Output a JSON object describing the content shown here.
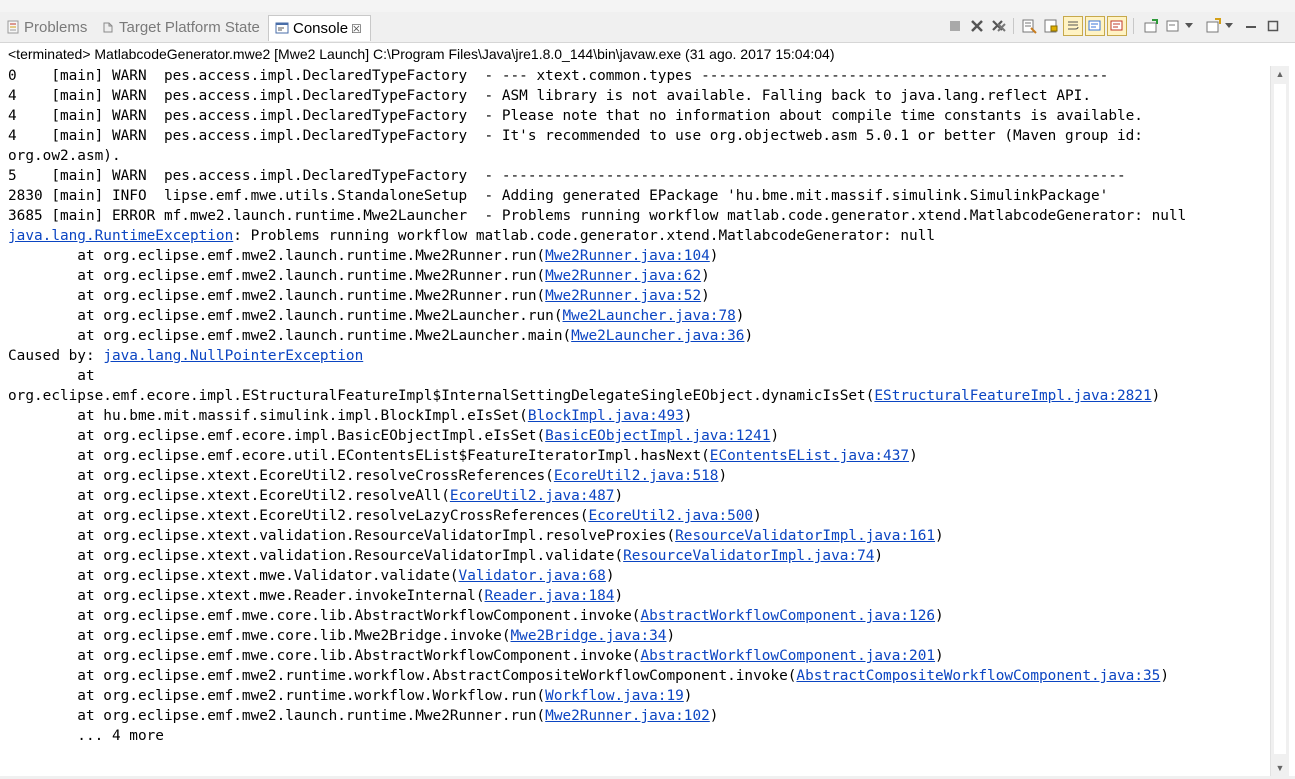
{
  "tabs": [
    {
      "label": "Problems",
      "icon": "problems-icon"
    },
    {
      "label": "Target Platform State",
      "icon": "target-platform-icon"
    },
    {
      "label": "Console",
      "icon": "console-icon",
      "close": "☒"
    }
  ],
  "status": "<terminated> MatlabcodeGenerator.mwe2 [Mwe2 Launch] C:\\Program Files\\Java\\jre1.8.0_144\\bin\\javaw.exe (31 ago. 2017 15:04:04)",
  "colors": {
    "link": "#0b45c2",
    "accent": "#3874d8"
  },
  "console": [
    [
      {
        "t": "0    [main] WARN  pes.access.impl.DeclaredTypeFactory  - --- xtext.common.types -----------------------------------------------"
      }
    ],
    [
      {
        "t": "4    [main] WARN  pes.access.impl.DeclaredTypeFactory  - ASM library is not available. Falling back to java.lang.reflect API."
      }
    ],
    [
      {
        "t": "4    [main] WARN  pes.access.impl.DeclaredTypeFactory  - Please note that no information about compile time constants is available."
      }
    ],
    [
      {
        "t": "4    [main] WARN  pes.access.impl.DeclaredTypeFactory  - It's recommended to use org.objectweb.asm 5.0.1 or better (Maven group id:"
      }
    ],
    [
      {
        "t": "org.ow2.asm)."
      }
    ],
    [
      {
        "t": "5    [main] WARN  pes.access.impl.DeclaredTypeFactory  - ------------------------------------------------------------------------"
      }
    ],
    [
      {
        "t": "2830 [main] INFO  lipse.emf.mwe.utils.StandaloneSetup  - Adding generated EPackage 'hu.bme.mit.massif.simulink.SimulinkPackage'"
      }
    ],
    [
      {
        "t": "3685 [main] ERROR mf.mwe2.launch.runtime.Mwe2Launcher  - Problems running workflow matlab.code.generator.xtend.MatlabcodeGenerator: null"
      }
    ],
    [
      {
        "t": "java.lang.RuntimeException",
        "link": true
      },
      {
        "t": ": Problems running workflow matlab.code.generator.xtend.MatlabcodeGenerator: null"
      }
    ],
    [
      {
        "t": "        at org.eclipse.emf.mwe2.launch.runtime.Mwe2Runner.run("
      },
      {
        "t": "Mwe2Runner.java:104",
        "link": true
      },
      {
        "t": ")"
      }
    ],
    [
      {
        "t": "        at org.eclipse.emf.mwe2.launch.runtime.Mwe2Runner.run("
      },
      {
        "t": "Mwe2Runner.java:62",
        "link": true
      },
      {
        "t": ")"
      }
    ],
    [
      {
        "t": "        at org.eclipse.emf.mwe2.launch.runtime.Mwe2Runner.run("
      },
      {
        "t": "Mwe2Runner.java:52",
        "link": true
      },
      {
        "t": ")"
      }
    ],
    [
      {
        "t": "        at org.eclipse.emf.mwe2.launch.runtime.Mwe2Launcher.run("
      },
      {
        "t": "Mwe2Launcher.java:78",
        "link": true
      },
      {
        "t": ")"
      }
    ],
    [
      {
        "t": "        at org.eclipse.emf.mwe2.launch.runtime.Mwe2Launcher.main("
      },
      {
        "t": "Mwe2Launcher.java:36",
        "link": true
      },
      {
        "t": ")"
      }
    ],
    [
      {
        "t": "Caused by: "
      },
      {
        "t": "java.lang.NullPointerException",
        "link": true
      }
    ],
    [
      {
        "t": "        at"
      }
    ],
    [
      {
        "t": "org.eclipse.emf.ecore.impl.EStructuralFeatureImpl$InternalSettingDelegateSingleEObject.dynamicIsSet("
      },
      {
        "t": "EStructuralFeatureImpl.java:2821",
        "link": true
      },
      {
        "t": ")"
      }
    ],
    [
      {
        "t": "        at hu.bme.mit.massif.simulink.impl.BlockImpl.eIsSet("
      },
      {
        "t": "BlockImpl.java:493",
        "link": true
      },
      {
        "t": ")"
      }
    ],
    [
      {
        "t": "        at org.eclipse.emf.ecore.impl.BasicEObjectImpl.eIsSet("
      },
      {
        "t": "BasicEObjectImpl.java:1241",
        "link": true
      },
      {
        "t": ")"
      }
    ],
    [
      {
        "t": "        at org.eclipse.emf.ecore.util.EContentsEList$FeatureIteratorImpl.hasNext("
      },
      {
        "t": "EContentsEList.java:437",
        "link": true
      },
      {
        "t": ")"
      }
    ],
    [
      {
        "t": "        at org.eclipse.xtext.EcoreUtil2.resolveCrossReferences("
      },
      {
        "t": "EcoreUtil2.java:518",
        "link": true
      },
      {
        "t": ")"
      }
    ],
    [
      {
        "t": "        at org.eclipse.xtext.EcoreUtil2.resolveAll("
      },
      {
        "t": "EcoreUtil2.java:487",
        "link": true
      },
      {
        "t": ")"
      }
    ],
    [
      {
        "t": "        at org.eclipse.xtext.EcoreUtil2.resolveLazyCrossReferences("
      },
      {
        "t": "EcoreUtil2.java:500",
        "link": true
      },
      {
        "t": ")"
      }
    ],
    [
      {
        "t": "        at org.eclipse.xtext.validation.ResourceValidatorImpl.resolveProxies("
      },
      {
        "t": "ResourceValidatorImpl.java:161",
        "link": true
      },
      {
        "t": ")"
      }
    ],
    [
      {
        "t": "        at org.eclipse.xtext.validation.ResourceValidatorImpl.validate("
      },
      {
        "t": "ResourceValidatorImpl.java:74",
        "link": true
      },
      {
        "t": ")"
      }
    ],
    [
      {
        "t": "        at org.eclipse.xtext.mwe.Validator.validate("
      },
      {
        "t": "Validator.java:68",
        "link": true
      },
      {
        "t": ")"
      }
    ],
    [
      {
        "t": "        at org.eclipse.xtext.mwe.Reader.invokeInternal("
      },
      {
        "t": "Reader.java:184",
        "link": true
      },
      {
        "t": ")"
      }
    ],
    [
      {
        "t": "        at org.eclipse.emf.mwe.core.lib.AbstractWorkflowComponent.invoke("
      },
      {
        "t": "AbstractWorkflowComponent.java:126",
        "link": true
      },
      {
        "t": ")"
      }
    ],
    [
      {
        "t": "        at org.eclipse.emf.mwe.core.lib.Mwe2Bridge.invoke("
      },
      {
        "t": "Mwe2Bridge.java:34",
        "link": true
      },
      {
        "t": ")"
      }
    ],
    [
      {
        "t": "        at org.eclipse.emf.mwe.core.lib.AbstractWorkflowComponent.invoke("
      },
      {
        "t": "AbstractWorkflowComponent.java:201",
        "link": true
      },
      {
        "t": ")"
      }
    ],
    [
      {
        "t": "        at org.eclipse.emf.mwe2.runtime.workflow.AbstractCompositeWorkflowComponent.invoke("
      },
      {
        "t": "AbstractCompositeWorkflowComponent.java:35",
        "link": true
      },
      {
        "t": ")"
      }
    ],
    [
      {
        "t": "        at org.eclipse.emf.mwe2.runtime.workflow.Workflow.run("
      },
      {
        "t": "Workflow.java:19",
        "link": true
      },
      {
        "t": ")"
      }
    ],
    [
      {
        "t": "        at org.eclipse.emf.mwe2.launch.runtime.Mwe2Runner.run("
      },
      {
        "t": "Mwe2Runner.java:102",
        "link": true
      },
      {
        "t": ")"
      }
    ],
    [
      {
        "t": "        ... 4 more"
      }
    ]
  ]
}
